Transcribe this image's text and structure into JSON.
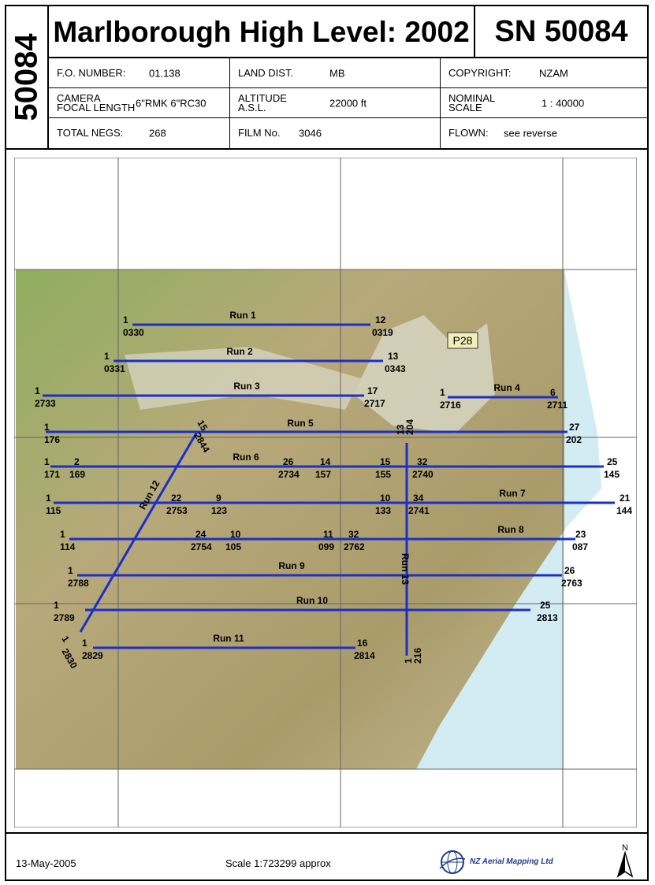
{
  "header": {
    "side_number": "50084",
    "title": "Marlborough High Level: 2002",
    "sn": "SN 50084",
    "fo_label": "F.O. NUMBER:",
    "fo_value": "01.138",
    "land_label": "LAND DIST.",
    "land_value": "MB",
    "copyright_label": "COPYRIGHT:",
    "copyright_value": "NZAM",
    "camera_label_1": "CAMERA",
    "camera_label_2": "FOCAL LENGTH",
    "camera_value": "6\"RMK  6\"RC30",
    "altitude_label_1": "ALTITUDE",
    "altitude_label_2": "A.S.L.",
    "altitude_value": "22000 ft",
    "scale_label_1": "NOMINAL",
    "scale_label_2": "SCALE",
    "scale_value": "1 : 40000",
    "negs_label": "TOTAL NEGS:",
    "negs_value": "268",
    "film_label": "FILM No.",
    "film_value": "3046",
    "flown_label": "FLOWN:",
    "flown_value": "see reverse"
  },
  "map": {
    "tile_label": "P28",
    "colors": {
      "run_line": "#1b2fc9",
      "sea": "#d3ecf3",
      "land": "#b9ac82",
      "plain": "#dad9c8",
      "hills": "#a99c6a",
      "green": "#88a65a",
      "grid": "#666666"
    },
    "runs": [
      {
        "name": "Run 1",
        "start": "1",
        "start_no": "0330",
        "end": "12",
        "end_no": "0319"
      },
      {
        "name": "Run 2",
        "start": "1",
        "start_no": "0331",
        "end": "13",
        "end_no": "0343"
      },
      {
        "name": "Run 3",
        "start": "1",
        "start_no": "2733",
        "end": "17",
        "end_no": "2717"
      },
      {
        "name": "Run 4",
        "start": "1",
        "start_no": "2716",
        "end": "6",
        "end_no": "2711"
      },
      {
        "name": "Run 5",
        "start": "1",
        "start_no": "176",
        "end": "27",
        "end_no": "202"
      },
      {
        "name": "Run 6",
        "start": "1",
        "start_no": "171",
        "end": "25",
        "end_no": "145"
      },
      {
        "name": "Run 7",
        "start": "1",
        "start_no": "115",
        "end": "21",
        "end_no": "144"
      },
      {
        "name": "Run 8",
        "start": "1",
        "start_no": "114",
        "end": "23",
        "end_no": "087"
      },
      {
        "name": "Run 9",
        "start": "1",
        "start_no": "2788",
        "end": "26",
        "end_no": "2763"
      },
      {
        "name": "Run 10",
        "start": "1",
        "start_no": "2789",
        "end": "25",
        "end_no": "2813"
      },
      {
        "name": "Run 11",
        "start": "1",
        "start_no": "2829",
        "end": "16",
        "end_no": "2814"
      },
      {
        "name": "Run 12",
        "start": "1",
        "start_no": "2830",
        "end": "15",
        "end_no": "2844"
      },
      {
        "name": "Run 13",
        "start": "1",
        "start_no": "216",
        "end": "13",
        "end_no": "204"
      }
    ],
    "intermediate": [
      {
        "frame": "2",
        "no": "169"
      },
      {
        "frame": "26",
        "no": "2734"
      },
      {
        "frame": "14",
        "no": "157"
      },
      {
        "frame": "15",
        "no": "155"
      },
      {
        "frame": "32",
        "no": "2740"
      },
      {
        "frame": "22",
        "no": "2753"
      },
      {
        "frame": "9",
        "no": "123"
      },
      {
        "frame": "10",
        "no": "133"
      },
      {
        "frame": "34",
        "no": "2741"
      },
      {
        "frame": "24",
        "no": "2754"
      },
      {
        "frame": "10",
        "no": "105"
      },
      {
        "frame": "11",
        "no": "099"
      },
      {
        "frame": "32",
        "no": "2762"
      }
    ]
  },
  "footer": {
    "date": "13-May-2005",
    "scale": "Scale  1:723299 approx",
    "company": "NZ Aerial Mapping Ltd",
    "north": "N"
  }
}
